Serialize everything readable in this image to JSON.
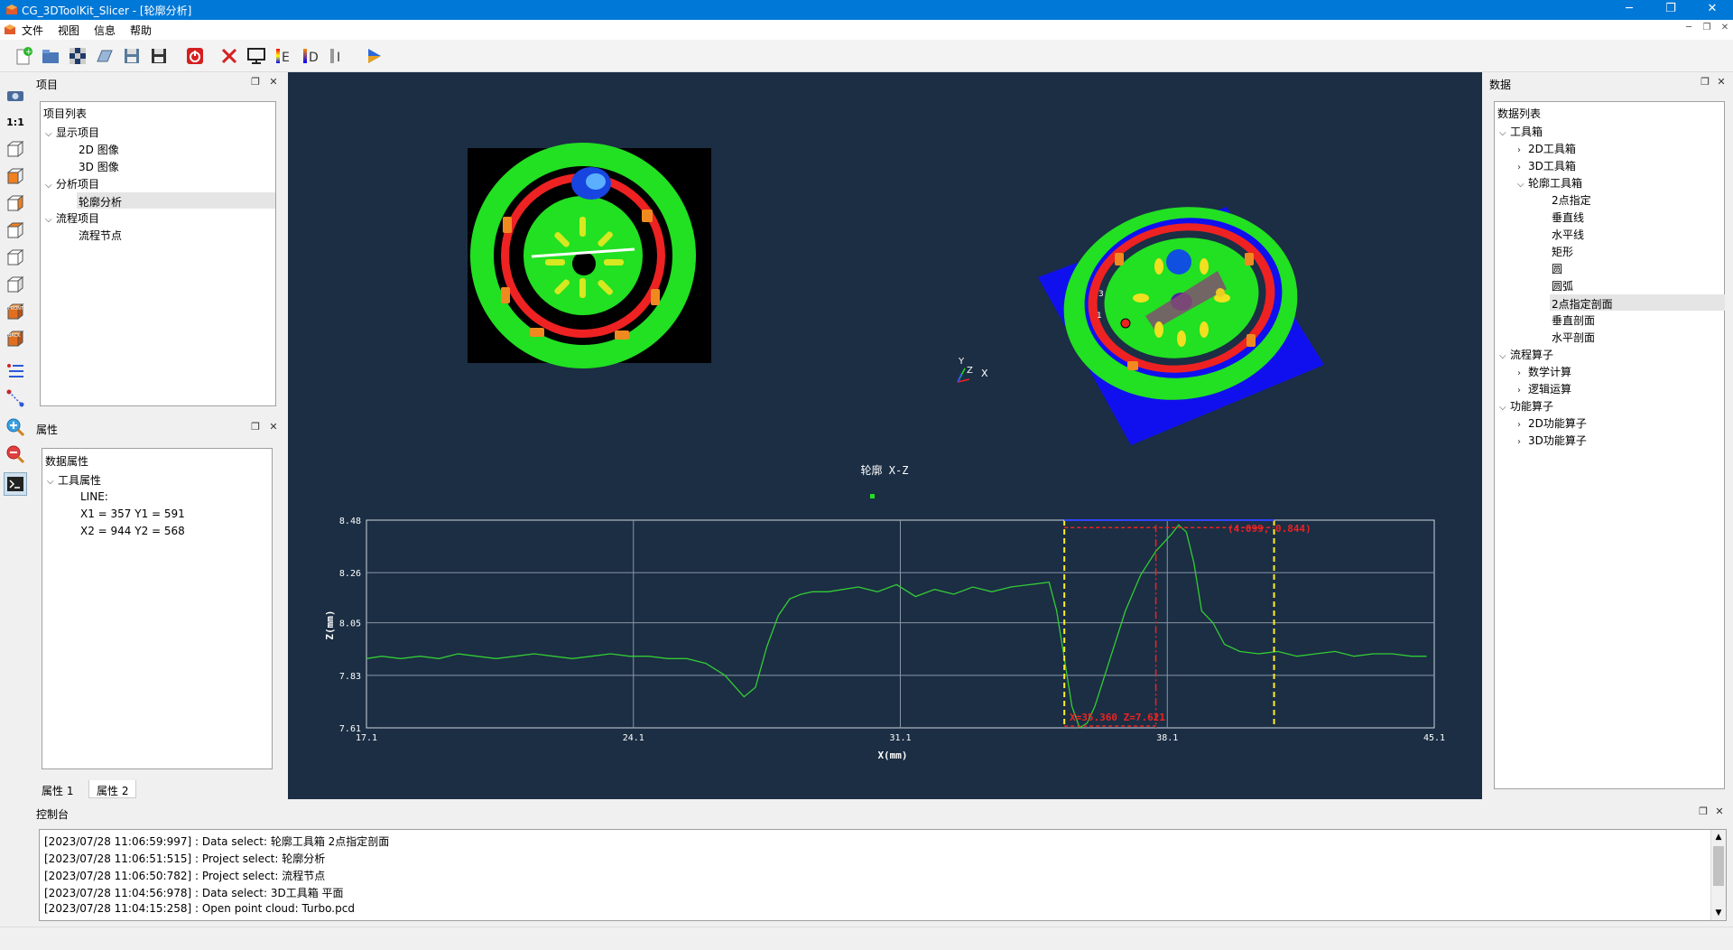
{
  "window": {
    "title": "CG_3DToolKit_Slicer - [轮廓分析]",
    "minimize": "─",
    "maximize": "❐",
    "close": "✕"
  },
  "menu": {
    "items": [
      "文件",
      "视图",
      "信息",
      "帮助"
    ]
  },
  "toolbar_icons": [
    "new-project-icon",
    "open-folder-icon",
    "checkerboard-icon",
    "open-file-icon",
    "save-icon",
    "save-as-icon",
    "power-icon",
    "delete-icon",
    "monitor-icon",
    "color-e-icon",
    "color-d-icon",
    "color-i-icon",
    "run-icon"
  ],
  "left_tools_icons": [
    "camera-icon",
    "one-to-one-icon",
    "cube-view-1-icon",
    "cube-view-2-icon",
    "cube-view-3-icon",
    "cube-view-4-icon",
    "cube-view-5-icon",
    "cube-view-6-icon",
    "front-view-icon",
    "back-view-icon",
    "list-view-icon",
    "points-icon",
    "zoom-in-icon",
    "zoom-out-icon",
    "terminal-icon"
  ],
  "left_tools_labels": {
    "one_to_one": "1:1",
    "front": "FRONT",
    "back": "BACK"
  },
  "project_panel": {
    "title": "项目",
    "tree_title": "项目列表",
    "groups": [
      {
        "label": "显示项目",
        "children": [
          "2D  图像",
          "3D  图像"
        ]
      },
      {
        "label": "分析项目",
        "children": [
          "轮廓分析"
        ]
      },
      {
        "label": "流程项目",
        "children": [
          "流程节点"
        ]
      }
    ],
    "selected": "轮廓分析"
  },
  "properties_panel": {
    "title": "属性",
    "tree_title": "数据属性",
    "group": "工具属性",
    "lines": [
      "LINE:",
      "X1 = 357  Y1 = 591",
      "X2 = 944  Y2 = 568"
    ],
    "tabs": [
      "属性 1",
      "属性 2"
    ],
    "active_tab": 1
  },
  "data_panel": {
    "title": "数据",
    "tree_title": "数据列表",
    "groups": [
      {
        "label": "工具箱",
        "expanded": true,
        "children": [
          {
            "label": "2D工具箱",
            "expanded": false
          },
          {
            "label": "3D工具箱",
            "expanded": false
          },
          {
            "label": "轮廓工具箱",
            "expanded": true,
            "children": [
              "2点指定",
              "垂直线",
              "水平线",
              "矩形",
              "圆",
              "圆弧",
              "2点指定剖面",
              "垂直剖面",
              "水平剖面"
            ]
          }
        ]
      },
      {
        "label": "流程算子",
        "expanded": true,
        "children": [
          {
            "label": "数学计算",
            "expanded": false
          },
          {
            "label": "逻辑运算",
            "expanded": false
          }
        ]
      },
      {
        "label": "功能算子",
        "expanded": true,
        "children": [
          {
            "label": "2D功能算子",
            "expanded": false
          },
          {
            "label": "3D功能算子",
            "expanded": false
          }
        ]
      }
    ],
    "selected": "2点指定剖面"
  },
  "viewport": {
    "axis_labels": {
      "x": "X",
      "y": "Y",
      "z": "Z"
    },
    "point_labels": {
      "p1": "1",
      "p3": "3"
    }
  },
  "chart_data": {
    "type": "line",
    "title": "轮廓 X-Z",
    "xlabel": "X(mm)",
    "ylabel": "Z(mm)",
    "xlim": [
      17.1,
      45.1
    ],
    "ylim": [
      7.61,
      8.48
    ],
    "xticks": [
      "17.1",
      "24.1",
      "31.1",
      "38.1",
      "45.1"
    ],
    "yticks": [
      "8.48",
      "8.26",
      "8.05",
      "7.83",
      "7.61"
    ],
    "grid": true,
    "series": [
      {
        "color": "#33cc33",
        "x": [
          17.1,
          17.5,
          18,
          18.5,
          19,
          19.5,
          20,
          20.5,
          21,
          21.5,
          22,
          22.5,
          23,
          23.5,
          24,
          24.5,
          25,
          25.5,
          26,
          26.5,
          27,
          27.3,
          27.6,
          27.9,
          28.2,
          28.5,
          28.8,
          29.2,
          29.6,
          30,
          30.5,
          31,
          31.5,
          32,
          32.5,
          33,
          33.5,
          34,
          34.5,
          35,
          35.2,
          35.4,
          35.6,
          35.8,
          36,
          36.2,
          36.6,
          37,
          37.4,
          37.8,
          38.2,
          38.4,
          38.6,
          38.8,
          39,
          39.3,
          39.6,
          40,
          40.5,
          41,
          41.5,
          42,
          42.5,
          43,
          43.5,
          44,
          44.5,
          44.9
        ],
        "values": [
          7.9,
          7.91,
          7.9,
          7.91,
          7.9,
          7.92,
          7.91,
          7.9,
          7.91,
          7.92,
          7.91,
          7.9,
          7.91,
          7.92,
          7.91,
          7.91,
          7.9,
          7.9,
          7.88,
          7.83,
          7.74,
          7.78,
          7.95,
          8.08,
          8.15,
          8.17,
          8.18,
          8.18,
          8.19,
          8.2,
          8.18,
          8.21,
          8.16,
          8.19,
          8.17,
          8.2,
          8.18,
          8.2,
          8.21,
          8.22,
          8.1,
          7.9,
          7.7,
          7.61,
          7.63,
          7.7,
          7.9,
          8.1,
          8.25,
          8.35,
          8.42,
          8.46,
          8.43,
          8.3,
          8.1,
          8.05,
          7.96,
          7.93,
          7.92,
          7.93,
          7.91,
          7.92,
          7.93,
          7.91,
          7.92,
          7.92,
          7.91,
          7.91
        ]
      }
    ],
    "annotations": {
      "peak": "(4.099, 0.844)",
      "cursor": "X=35.360   Z=7.621"
    }
  },
  "console": {
    "title": "控制台",
    "lines": [
      "[2023/07/28 11:06:59:997] : Data select: 轮廓工具箱  2点指定剖面",
      "[2023/07/28 11:06:51:515] : Project select: 轮廓分析",
      "[2023/07/28 11:06:50:782] : Project select: 流程节点",
      "[2023/07/28 11:04:56:978] : Data select: 3D工具箱  平面",
      "[2023/07/28 11:04:15:258] : Open point cloud: Turbo.pcd"
    ]
  },
  "colors": {
    "titlebar": "#0078d7",
    "viewport_bg": "#1b2e44",
    "green": "#22e022",
    "red": "#ee2222",
    "blue": "#1010ee",
    "selection": "#e5e5e5"
  }
}
